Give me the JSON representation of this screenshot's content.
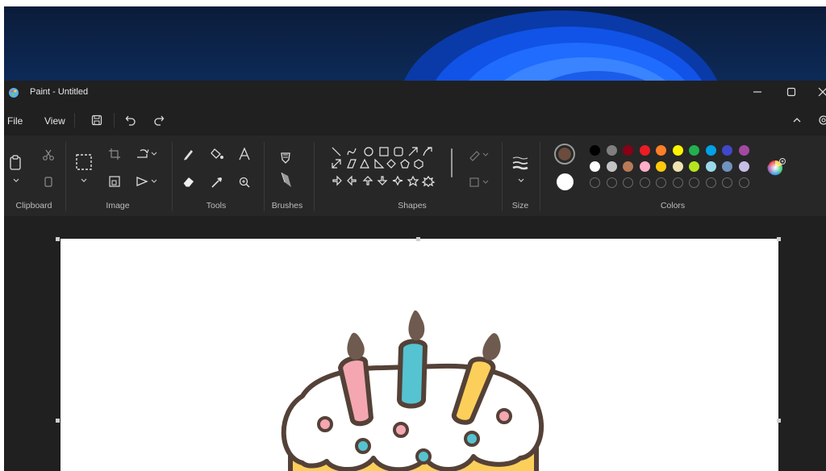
{
  "window": {
    "title": "Paint - Untitled"
  },
  "menu": {
    "file": "File",
    "view": "View"
  },
  "ribbon": {
    "groups": {
      "clipboard": "Clipboard",
      "image": "Image",
      "tools": "Tools",
      "brushes": "Brushes",
      "shapes": "Shapes",
      "size": "Size",
      "colors": "Colors"
    }
  },
  "colors": {
    "primary": "#6b4c3d",
    "secondary": "#ffffff",
    "palette_row1": [
      "#000000",
      "#7f7f7f",
      "#880015",
      "#ed1c24",
      "#ff7f27",
      "#fff200",
      "#22b14c",
      "#00a2e8",
      "#3f48cc",
      "#a349a4"
    ],
    "palette_row2": [
      "#ffffff",
      "#c3c3c3",
      "#b97a57",
      "#ffaec9",
      "#ffc90e",
      "#efe4b0",
      "#b5e61d",
      "#99d9ea",
      "#7092be",
      "#c8bfe7"
    ]
  },
  "icons": [
    "paint-app-icon",
    "save-icon",
    "undo-icon",
    "redo-icon",
    "minimize-icon",
    "maximize-icon",
    "close-icon",
    "collapse-ribbon-icon",
    "settings-icon",
    "clipboard-paste-icon",
    "cut-icon",
    "copy-icon",
    "select-icon",
    "crop-icon",
    "resize-icon",
    "rotate-icon",
    "flip-icon",
    "pencil-icon",
    "fill-icon",
    "text-icon",
    "eraser-icon",
    "color-picker-icon",
    "magnifier-icon",
    "brush-icon",
    "outline-icon",
    "shape-fill-icon",
    "size-lines-icon",
    "edit-colors-icon"
  ]
}
